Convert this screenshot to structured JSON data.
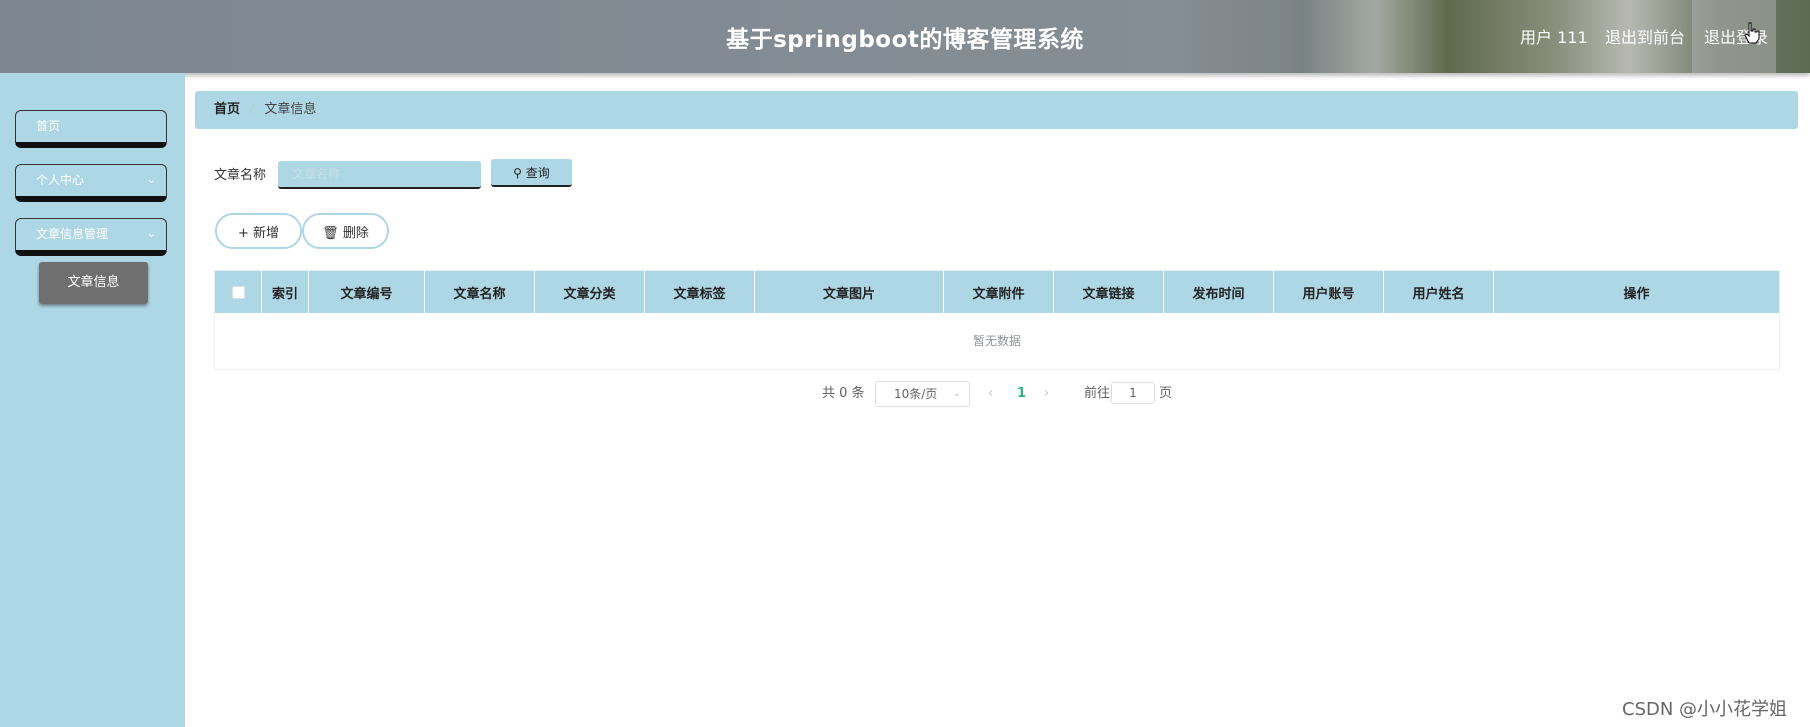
{
  "header": {
    "title": "基于springboot的博客管理系统",
    "user": "用户 111",
    "back_label": "退出到前台",
    "logout_label": "退出登录"
  },
  "sidebar": {
    "items": [
      {
        "label": "首页"
      },
      {
        "label": "个人中心"
      },
      {
        "label": "文章信息管理"
      }
    ],
    "submenu_active": "文章信息"
  },
  "breadcrumb": {
    "home": "首页",
    "separator": "/",
    "current": "文章信息"
  },
  "search": {
    "label": "文章名称",
    "placeholder": "文章名称",
    "query_label": "查询"
  },
  "actions": {
    "add_label": "新增",
    "delete_label": "删除"
  },
  "table": {
    "columns": [
      "索引",
      "文章编号",
      "文章名称",
      "文章分类",
      "文章标签",
      "文章图片",
      "文章附件",
      "文章链接",
      "发布时间",
      "用户账号",
      "用户姓名",
      "操作"
    ],
    "empty_text": "暂无数据"
  },
  "pagination": {
    "total": "共 0 条",
    "page_size": "10条/页",
    "current_page": "1",
    "goto_label": "前往",
    "goto_value": "1",
    "page_unit": "页"
  },
  "watermark": "CSDN @小小花学姐",
  "colors": {
    "accent": "#aed7e6",
    "active_submenu": "#6f6f6f",
    "current_page": "#2bb38a"
  }
}
